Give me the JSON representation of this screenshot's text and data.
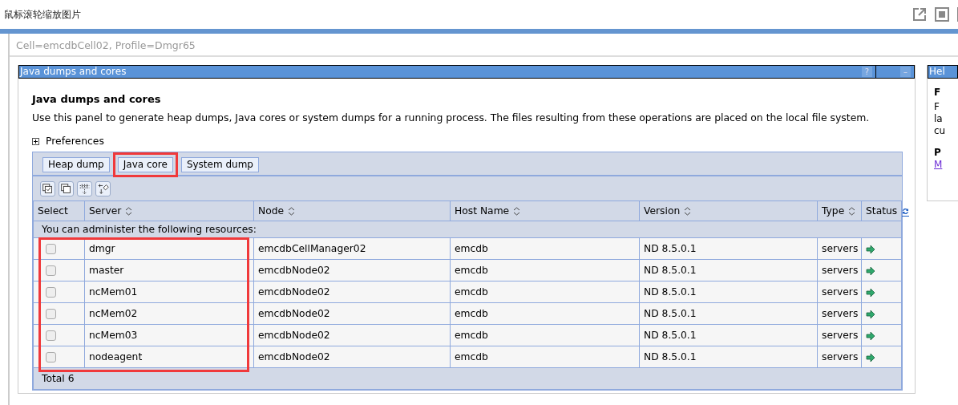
{
  "window": {
    "title": "鼠标滚轮缩放图片"
  },
  "breadcrumb": "Cell=emcdbCell02, Profile=Dmgr65",
  "panel": {
    "title": "Java dumps and cores",
    "heading": "Java dumps and cores",
    "description": "Use this panel to generate heap dumps, Java cores or system dumps for a running process. The files resulting from these operations are placed on the local file system.",
    "help_button": "?",
    "collapse_button": "–",
    "preferences": {
      "label": "Preferences",
      "expanded": false
    }
  },
  "buttons": [
    {
      "label": "Heap dump",
      "highlighted": false
    },
    {
      "label": "Java core",
      "highlighted": true
    },
    {
      "label": "System dump",
      "highlighted": false
    }
  ],
  "table": {
    "server_rows_highlighted": true,
    "columns": [
      {
        "label": "Select",
        "sortable": false
      },
      {
        "label": "Server",
        "sortable": true
      },
      {
        "label": "Node",
        "sortable": true
      },
      {
        "label": "Host Name",
        "sortable": true
      },
      {
        "label": "Version",
        "sortable": true
      },
      {
        "label": "Type",
        "sortable": true
      },
      {
        "label": "Status",
        "sortable": false
      }
    ],
    "note": "You can administer the following resources:",
    "rows": [
      {
        "checked": false,
        "server": "dmgr",
        "node": "emcdbCellManager02",
        "host": "emcdb",
        "version": "ND 8.5.0.1",
        "type": "servers",
        "running": true
      },
      {
        "checked": false,
        "server": "master",
        "node": "emcdbNode02",
        "host": "emcdb",
        "version": "ND 8.5.0.1",
        "type": "servers",
        "running": true
      },
      {
        "checked": false,
        "server": "ncMem01",
        "node": "emcdbNode02",
        "host": "emcdb",
        "version": "ND 8.5.0.1",
        "type": "servers",
        "running": true
      },
      {
        "checked": false,
        "server": "ncMem02",
        "node": "emcdbNode02",
        "host": "emcdb",
        "version": "ND 8.5.0.1",
        "type": "servers",
        "running": true
      },
      {
        "checked": false,
        "server": "ncMem03",
        "node": "emcdbNode02",
        "host": "emcdb",
        "version": "ND 8.5.0.1",
        "type": "servers",
        "running": true
      },
      {
        "checked": false,
        "server": "nodeagent",
        "node": "emcdbNode02",
        "host": "emcdb",
        "version": "ND 8.5.0.1",
        "type": "servers",
        "running": true
      }
    ],
    "total": "Total 6"
  },
  "help": {
    "title": "Hel",
    "heading_1": "F",
    "lines": [
      "F",
      "la",
      "cu"
    ],
    "heading_2": "P",
    "link": "M"
  }
}
